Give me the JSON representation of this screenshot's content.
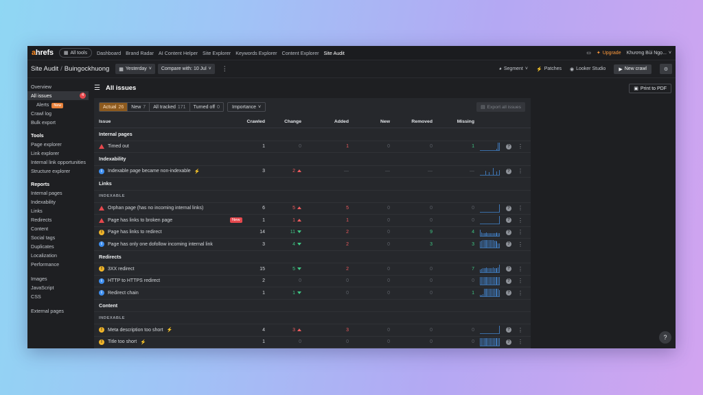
{
  "topbar": {
    "logo_a": "a",
    "logo_rest": "hrefs",
    "all_tools": "All tools",
    "nav": [
      "Dashboard",
      "Brand Radar",
      "AI Content Helper",
      "Site Explorer",
      "Keywords Explorer",
      "Content Explorer",
      "Site Audit"
    ],
    "upgrade": "Upgrade",
    "user": "Khương Bùi Ngọ..."
  },
  "subbar": {
    "crumb_root": "Site Audit",
    "crumb_sep": "/",
    "crumb_project": "Buingockhuong",
    "date": "Yesterday",
    "compare": "Compare with: 10 Jul",
    "segment": "Segment",
    "patches": "Patches",
    "looker": "Looker Studio",
    "new_crawl": "New crawl"
  },
  "sidebar": {
    "overview": "Overview",
    "all_issues": "All issues",
    "all_issues_count": "4",
    "alerts": "Alerts",
    "alerts_tag": "New",
    "crawl_log": "Crawl log",
    "bulk_export": "Bulk export",
    "tools_head": "Tools",
    "tools": [
      "Page explorer",
      "Link explorer",
      "Internal link opportunities",
      "Structure explorer"
    ],
    "reports_head": "Reports",
    "reports": [
      "Internal pages",
      "Indexability",
      "Links",
      "Redirects",
      "Content",
      "Social tags",
      "Duplicates",
      "Localization",
      "Performance"
    ],
    "resources": [
      "Images",
      "JavaScript",
      "CSS"
    ],
    "external": "External pages"
  },
  "main": {
    "title": "All issues",
    "print": "Print to PDF",
    "filters": {
      "actual": "Actual",
      "actual_n": "26",
      "new": "New",
      "new_n": "7",
      "tracked": "All tracked",
      "tracked_n": "171",
      "off": "Turned off",
      "off_n": "0",
      "importance": "Importance",
      "export": "Export all issues"
    },
    "columns": {
      "issue": "Issue",
      "crawled": "Crawled",
      "change": "Change",
      "added": "Added",
      "new": "New",
      "removed": "Removed",
      "missing": "Missing"
    },
    "sections": {
      "internal": "Internal pages",
      "indexability": "Indexability",
      "links": "Links",
      "links_sub": "INDEXABLE",
      "redirects": "Redirects",
      "content": "Content",
      "content_sub": "INDEXABLE"
    },
    "rows": [
      {
        "name": "Timed out",
        "crawled": "1",
        "change": "0",
        "added": "1",
        "new": "0",
        "removed": "0",
        "missing": "1"
      },
      {
        "name": "Indexable page became non-indexable",
        "crawled": "3",
        "change": "2",
        "added": "—",
        "new": "—",
        "removed": "—",
        "missing": "—"
      },
      {
        "name": "Orphan page (has no incoming internal links)",
        "crawled": "6",
        "change": "5",
        "added": "5",
        "new": "0",
        "removed": "0",
        "missing": "0"
      },
      {
        "name": "Page has links to broken page",
        "tag": "New",
        "crawled": "1",
        "change": "1",
        "added": "1",
        "new": "0",
        "removed": "0",
        "missing": "0"
      },
      {
        "name": "Page has links to redirect",
        "crawled": "14",
        "change": "11",
        "added": "2",
        "new": "0",
        "removed": "9",
        "missing": "4"
      },
      {
        "name": "Page has only one dofollow incoming internal link",
        "crawled": "3",
        "change": "4",
        "added": "2",
        "new": "0",
        "removed": "3",
        "missing": "3"
      },
      {
        "name": "3XX redirect",
        "crawled": "15",
        "change": "5",
        "added": "2",
        "new": "0",
        "removed": "0",
        "missing": "7"
      },
      {
        "name": "HTTP to HTTPS redirect",
        "crawled": "2",
        "change": "0",
        "added": "0",
        "new": "0",
        "removed": "0",
        "missing": "0"
      },
      {
        "name": "Redirect chain",
        "crawled": "1",
        "change": "1",
        "added": "0",
        "new": "0",
        "removed": "0",
        "missing": "1"
      },
      {
        "name": "Meta description too short",
        "crawled": "4",
        "change": "3",
        "added": "3",
        "new": "0",
        "removed": "0",
        "missing": "0"
      },
      {
        "name": "Title too short",
        "crawled": "1",
        "change": "0",
        "added": "0",
        "new": "0",
        "removed": "0",
        "missing": "0"
      }
    ],
    "help_fab": "?"
  },
  "colors": {
    "accent": "#ff8a1f",
    "error": "#e5484d",
    "warning": "#f0b429",
    "info": "#3d8ef0",
    "up": "#ef5b5e",
    "down": "#3fc884"
  }
}
